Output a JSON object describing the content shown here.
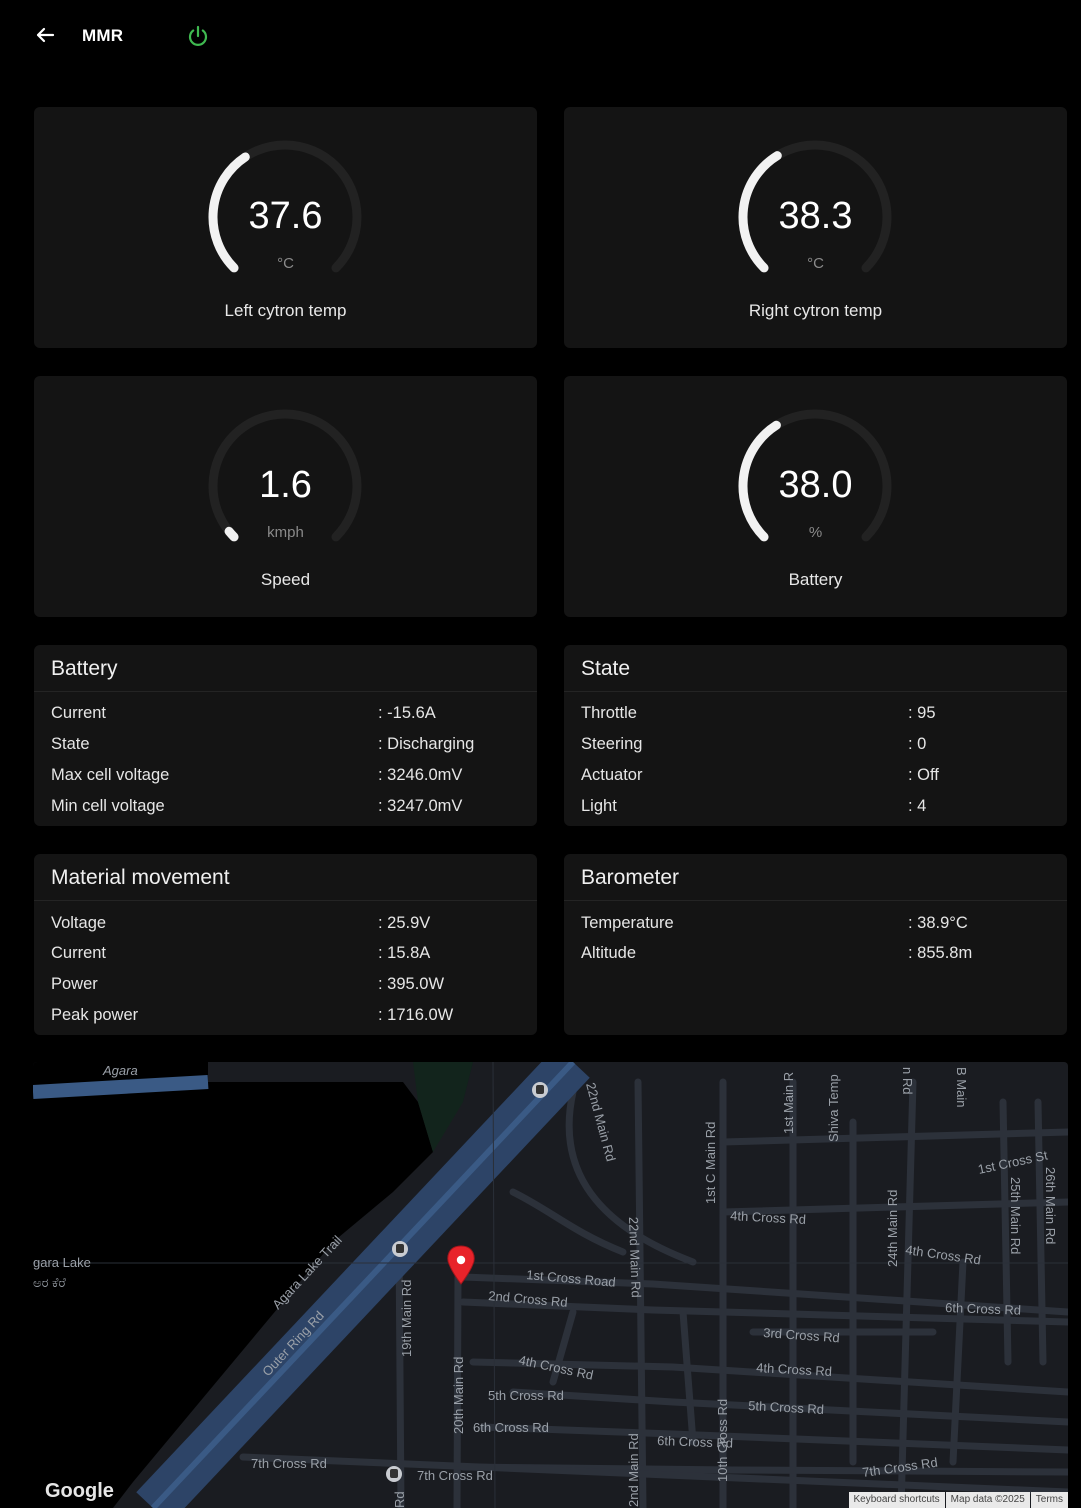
{
  "header": {
    "title": "MMR",
    "back_icon": "arrow-left-icon",
    "power_icon": "power-icon",
    "power_color": "#3fb950"
  },
  "gauges": [
    {
      "value": "37.6",
      "unit": "°C",
      "label": "Left cytron temp",
      "fraction": 0.376
    },
    {
      "value": "38.3",
      "unit": "°C",
      "label": "Right cytron temp",
      "fraction": 0.383
    },
    {
      "value": "1.6",
      "unit": "kmph",
      "label": "Speed",
      "fraction": 0.02
    },
    {
      "value": "38.0",
      "unit": "%",
      "label": "Battery",
      "fraction": 0.38
    }
  ],
  "battery": {
    "title": "Battery",
    "rows": [
      {
        "key": "Current",
        "value": ": -15.6A"
      },
      {
        "key": "State",
        "value": ": Discharging"
      },
      {
        "key": "Max cell voltage",
        "value": ": 3246.0mV"
      },
      {
        "key": "Min cell voltage",
        "value": ": 3247.0mV"
      }
    ]
  },
  "state": {
    "title": "State",
    "rows": [
      {
        "key": "Throttle",
        "value": ": 95"
      },
      {
        "key": "Steering",
        "value": ": 0"
      },
      {
        "key": "Actuator",
        "value": ": Off"
      },
      {
        "key": "Light",
        "value": ": 4"
      }
    ]
  },
  "material": {
    "title": "Material movement",
    "rows": [
      {
        "key": "Voltage",
        "value": ": 25.9V"
      },
      {
        "key": "Current",
        "value": ": 15.8A"
      },
      {
        "key": "Power",
        "value": ": 395.0W"
      },
      {
        "key": "Peak power",
        "value": ": 1716.0W"
      }
    ]
  },
  "barometer": {
    "title": "Barometer",
    "rows": [
      {
        "key": "Temperature",
        "value": ": 38.9°C"
      },
      {
        "key": "Altitude",
        "value": ": 855.8m"
      }
    ]
  },
  "map": {
    "labels": {
      "lake": "gara Lake",
      "lake_local": "ಅರ ಕೆರೆ",
      "agara": "Agara",
      "trail": "Agara Lake Trail",
      "orr": "Outer Ring Rd",
      "main19": "19th Main Rd",
      "main20": "20th Main Rd",
      "main22a": "22nd Main Rd",
      "main22b": "22nd Main Rd",
      "main22c": "2nd Main Rd",
      "c1main": "1st C Main Rd",
      "main1": "1st Main R",
      "shiva": "Shiva Temp",
      "nrd": "n Rd",
      "bmain": "B Main",
      "main24": "24th Main Rd",
      "main25": "25th Main Rd",
      "main26": "26th Main Rd",
      "cross10": "10th Cross Rd",
      "cross1road": "1st Cross Road",
      "cross1st": "1st Cross St",
      "cross2": "2nd Cross Rd",
      "cross3": "3rd Cross Rd",
      "cross4a": "4th Cross Rd",
      "cross4b": "4th Cross Rd",
      "cross4c": "4th Cross Rd",
      "cross4d": "4th Cross Rd",
      "cross5a": "5th Cross Rd",
      "cross5b": "5th Cross Rd",
      "cross6a": "6th Cross Rd",
      "cross6b": "6th Cross Rd",
      "cross6c": "6th Cross Rd",
      "cross7a": "7th Cross Rd",
      "cross7b": "7th Cross Rd",
      "cross7c": "7th Cross Rd",
      "rd": "Rd"
    },
    "pin_color": "#e8232a",
    "google": "Google",
    "attrib_shortcuts": "Keyboard shortcuts",
    "attrib_data": "Map data ©2025",
    "attrib_terms": "Terms"
  }
}
